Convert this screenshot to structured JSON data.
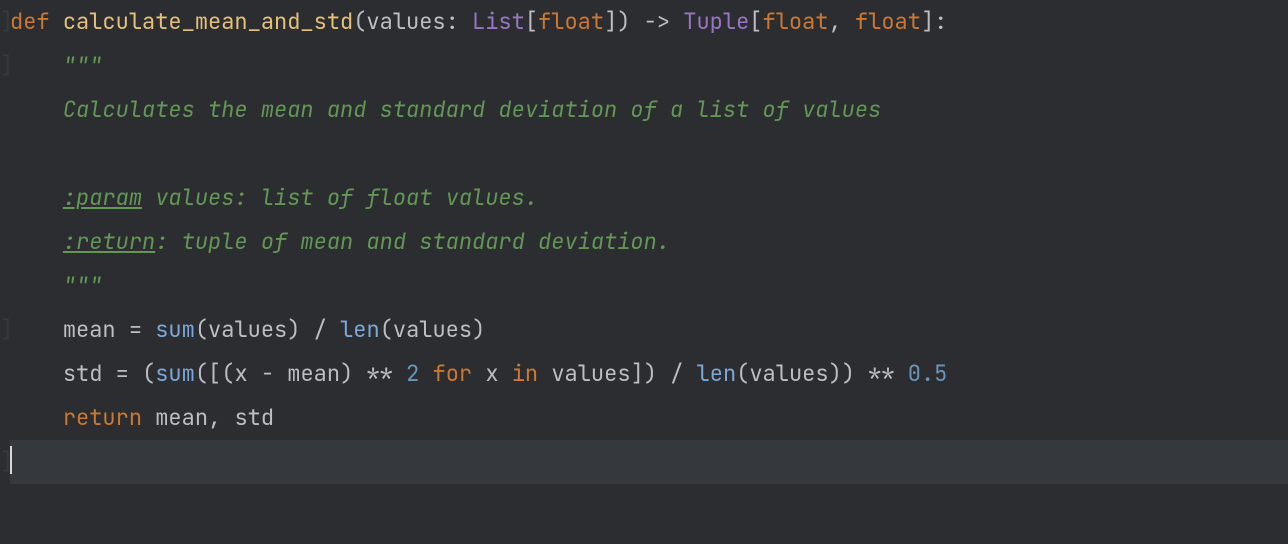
{
  "code": {
    "keywords": {
      "def": "def",
      "ret": "return",
      "for": "for",
      "in": "in"
    },
    "fn_name": "calculate_mean_and_std",
    "params_name": "values",
    "types": {
      "list": "List",
      "tuple": "Tuple",
      "float": "float"
    },
    "docstring": {
      "q": "\"\"\"",
      "summary": "Calculates the mean and standard deviation of a list of values",
      "param_tag": ":param",
      "param_rest": " values: list of float values.",
      "return_tag": ":return",
      "return_rest": ": tuple of mean and standard deviation."
    },
    "ids": {
      "mean": "mean",
      "std": "std",
      "x": "x",
      "values": "values"
    },
    "builtins": {
      "sum": "sum",
      "len": "len"
    },
    "nums": {
      "two": "2",
      "half": "0.5"
    },
    "ops": {
      "assign": " = ",
      "arrow": " -> ",
      "dstar": " ** ",
      "minus": " - ",
      "div": " / ",
      "comma_sp": ", "
    },
    "punct": {
      "lp": "(",
      "rp": ")",
      "lb": "[",
      "rb": "]",
      "colon": ":"
    }
  }
}
